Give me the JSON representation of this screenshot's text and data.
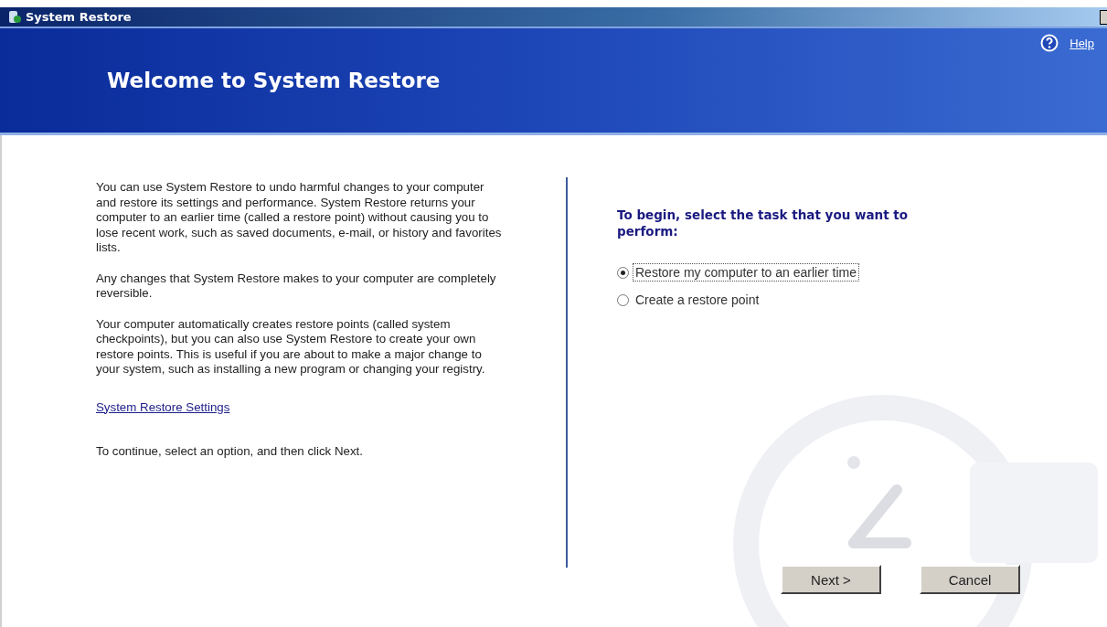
{
  "window": {
    "title": "System Restore"
  },
  "header": {
    "title": "Welcome to System Restore",
    "help_link": "Help"
  },
  "intro": {
    "paragraphs": [
      "You can use System Restore to undo harmful changes to your computer and restore its settings and performance. System Restore returns your computer to an earlier time (called a restore point) without causing you to lose recent work, such as saved documents, e-mail, or history and favorites lists.",
      "Any changes that System Restore makes to your computer are completely reversible.",
      "Your computer automatically creates restore points (called system checkpoints), but you can also use System Restore to create your own restore points. This is useful if you are about to make a major change to your system, such as installing a new program or changing your registry."
    ],
    "settings_link": "System Restore Settings",
    "footer_note": "To continue, select an option, and then click Next."
  },
  "task": {
    "prompt": "To begin, select the task that you want to perform:",
    "options": [
      {
        "label": "Restore my computer to an earlier time",
        "selected": true
      },
      {
        "label": "Create a restore point",
        "selected": false
      }
    ]
  },
  "buttons": [
    "Next >",
    "Cancel"
  ]
}
